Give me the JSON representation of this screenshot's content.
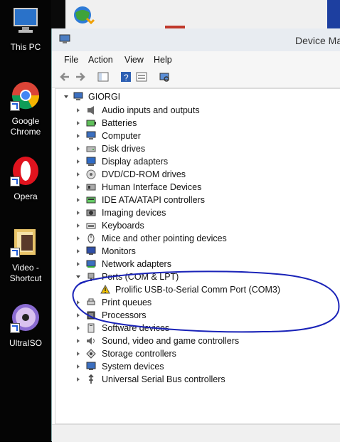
{
  "desktop": {
    "icons": [
      {
        "label": "This PC",
        "name": "this-pc"
      },
      {
        "label": "Google\nChrome",
        "name": "google-chrome"
      },
      {
        "label": "Opera",
        "name": "opera"
      },
      {
        "label": "Video -\nShortcut",
        "name": "video-shortcut"
      },
      {
        "label": "UltraISO",
        "name": "ultraiso"
      }
    ]
  },
  "window": {
    "title": "Device Ma",
    "menu": [
      "File",
      "Action",
      "View",
      "Help"
    ]
  },
  "tree": {
    "root": "GIORGI",
    "items": [
      "Audio inputs and outputs",
      "Batteries",
      "Computer",
      "Disk drives",
      "Display adapters",
      "DVD/CD-ROM drives",
      "Human Interface Devices",
      "IDE ATA/ATAPI controllers",
      "Imaging devices",
      "Keyboards",
      "Mice and other pointing devices",
      "Monitors",
      "Network adapters",
      "Ports (COM & LPT)",
      "Prolific USB-to-Serial Comm Port (COM3)",
      "Print queues",
      "Processors",
      "Software devices",
      "Sound, video and game controllers",
      "Storage controllers",
      "System devices",
      "Universal Serial Bus controllers"
    ]
  },
  "colors": {
    "annotation": "#1a23b8",
    "warning": "#f2c200"
  }
}
